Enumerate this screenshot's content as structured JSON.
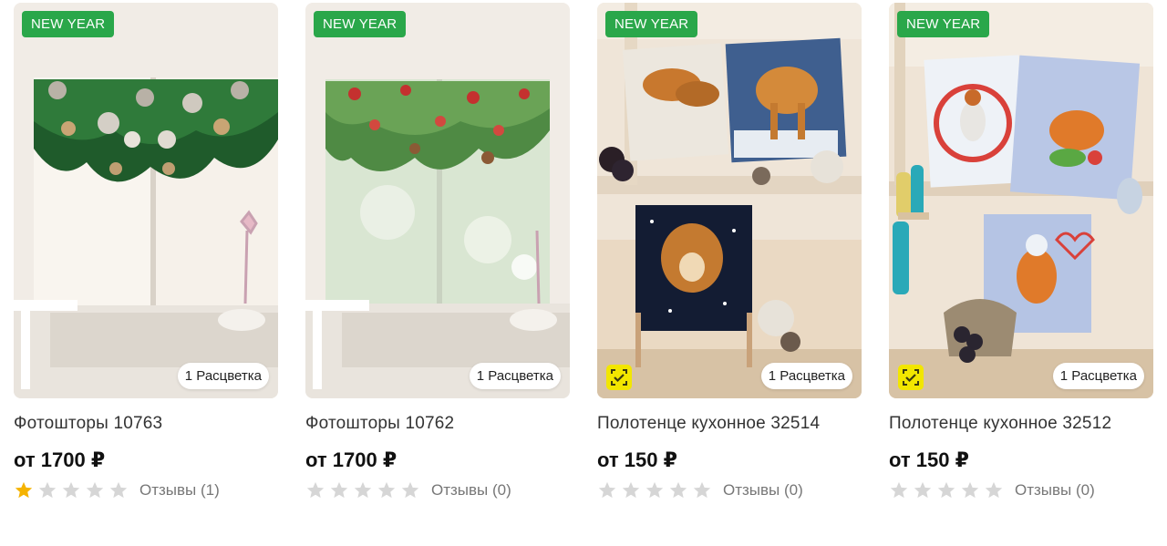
{
  "colors": {
    "badge_new": "#2aa74a",
    "star_filled": "#f5b301",
    "star_empty": "#d6d6d6",
    "tag_icon": "#f2e600"
  },
  "products": [
    {
      "badge": "NEW YEAR",
      "colors_pill": "1 Расцветка",
      "title": "Фотошторы 10763",
      "price": "от 1700 ₽",
      "rating": 1,
      "reviews": "Отзывы (1)",
      "image": "curtains-garland-white"
    },
    {
      "badge": "NEW YEAR",
      "colors_pill": "1 Расцветка",
      "title": "Фотошторы 10762",
      "price": "от 1700 ₽",
      "rating": 0,
      "reviews": "Отзывы (0)",
      "image": "curtains-garland-bokeh"
    },
    {
      "badge": "NEW YEAR",
      "colors_pill": "1 Расцветка",
      "title": "Полотенце кухонное 32514",
      "price": "от 150 ₽",
      "rating": 0,
      "reviews": "Отзывы (0)",
      "image": "towels-tigers",
      "tag_icon": "check-tag-icon"
    },
    {
      "badge": "NEW YEAR",
      "colors_pill": "1 Расцветка",
      "title": "Полотенце кухонное 32512",
      "price": "от 150 ₽",
      "rating": 0,
      "reviews": "Отзывы (0)",
      "image": "towels-tiger-chef",
      "tag_icon": "check-tag-icon"
    }
  ]
}
